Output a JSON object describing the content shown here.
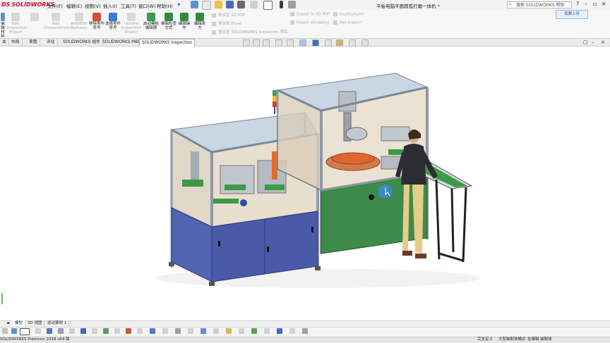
{
  "app": {
    "logo_text": "SOLIDWORKS",
    "logo_mark": "DS"
  },
  "menu": [
    "文件(F)",
    "编辑(E)",
    "视图(V)",
    "插入(I)",
    "工具(T)",
    "窗口(W)",
    "帮助(H)"
  ],
  "document_title": "平板电脑平面圆弧打磨一体机 *",
  "search": {
    "placeholder": "搜索 SOLIDWORKS 帮助"
  },
  "upload_label": "我要上传",
  "ribbon": {
    "left_buttons": [
      {
        "label": "编辑材料",
        "enabled": true
      },
      {
        "label": "Edit Inspection Project",
        "enabled": false
      },
      {
        "label": "Add Characteristic",
        "enabled": false
      },
      {
        "label": "Add/Edit Balloons",
        "enabled": false
      },
      {
        "label": "移除零件序号",
        "enabled": true
      },
      {
        "label": "选择零件序号",
        "enabled": true
      },
      {
        "label": "Update Inspection Project",
        "enabled": false
      },
      {
        "label": "启动模板编辑器",
        "enabled": true
      },
      {
        "label": "编辑检查方式",
        "enabled": true
      },
      {
        "label": "编辑操作",
        "enabled": true
      },
      {
        "label": "编辑卖方",
        "enabled": true
      }
    ],
    "export_col1": [
      "导出至 2D PDF",
      "导出至 Excel",
      "导出至 SOLIDWORKS Inspection 项目"
    ],
    "export_col2": [
      "Export to 3D PDF",
      "Export eDrawing"
    ],
    "export_col3": [
      "QualityXpert",
      "Net-Inspect"
    ]
  },
  "tabs": [
    {
      "label": "本",
      "active": false
    },
    {
      "label": "布局",
      "active": false
    },
    {
      "label": "草图",
      "active": false
    },
    {
      "label": "评估",
      "active": false
    },
    {
      "label": "SOLIDWORKS 插件",
      "active": false
    },
    {
      "label": "SOLIDWORKS MBD",
      "active": false
    },
    {
      "label": "SOLIDWORKS Inspection",
      "active": true
    }
  ],
  "bottom_tabs": [
    {
      "label": "模型",
      "active": true
    },
    {
      "label": "3D 视图",
      "active": false
    },
    {
      "label": "运动算例 1",
      "active": false
    }
  ],
  "status": {
    "left": "SOLIDWORKS Premium 2018 x64 版",
    "right": [
      "完全定义",
      "大型装配体模式",
      "在编辑 装配体"
    ]
  },
  "colors": {
    "frame": "#b9c3cf",
    "cabinet_blue": "#4a5aa8",
    "cabinet_green": "#3e8a4a",
    "glass": "#d8cbb6",
    "accent_orange": "#e1662e"
  }
}
